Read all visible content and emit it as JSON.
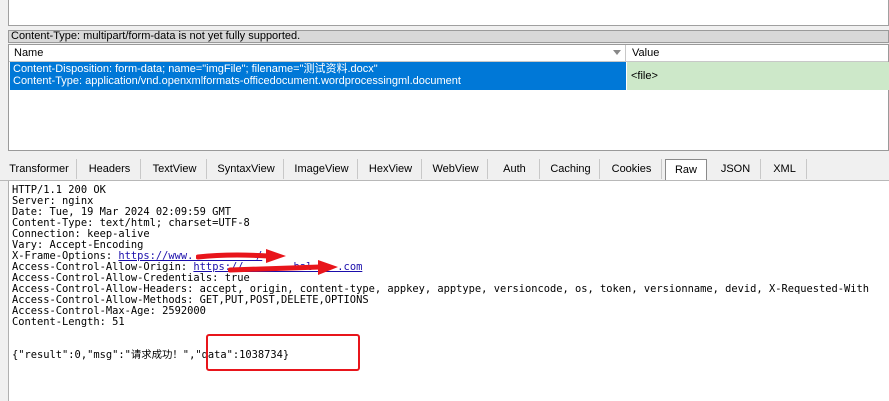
{
  "content_type_note": "Content-Type: multipart/form-data is not yet fully supported.",
  "grid": {
    "col_name": "Name",
    "col_value": "Value",
    "row_name_line1": "Content-Disposition: form-data; name=\"imgFile\"; filename=\"测试资料.docx\"",
    "row_name_line2": "Content-Type: application/vnd.openxmlformats-officedocument.wordprocessingml.document",
    "row_value": "<file>"
  },
  "tabs": [
    "Transformer",
    "Headers",
    "TextView",
    "SyntaxView",
    "ImageView",
    "HexView",
    "WebView",
    "Auth",
    "Caching",
    "Cookies",
    "Raw",
    "JSON",
    "XML"
  ],
  "active_tab": "Raw",
  "response": {
    "status": "HTTP/1.1 200 OK",
    "server": "Server: nginx",
    "date": "Date: Tue, 19 Mar 2024 02:09:59 GMT",
    "content_type": "Content-Type: text/html; charset=UTF-8",
    "connection": "Connection: keep-alive",
    "vary": "Vary: Accept-Encoding",
    "xfo_key": "X-Frame-Options: ",
    "xfo_val": "https://www.          /",
    "acao_key": "Access-Control-Allow-Origin: ",
    "acao_val": "https://       .bal    .com",
    "acac": "Access-Control-Allow-Credentials: true",
    "acah": "Access-Control-Allow-Headers: accept, origin, content-type, appkey, apptype, versioncode, os, token, versionname, devid, X-Requested-With",
    "acam": "Access-Control-Allow-Methods: GET,PUT,POST,DELETE,OPTIONS",
    "acma": "Access-Control-Max-Age: 2592000",
    "content_length": "Content-Length: 51",
    "body": "{\"result\":0,\"msg\":\"请求成功！\",\"data\":1038734}"
  },
  "colors": {
    "selection": "#0078d7",
    "value_cell": "#cde8c9",
    "annotation": "#e8151b"
  }
}
